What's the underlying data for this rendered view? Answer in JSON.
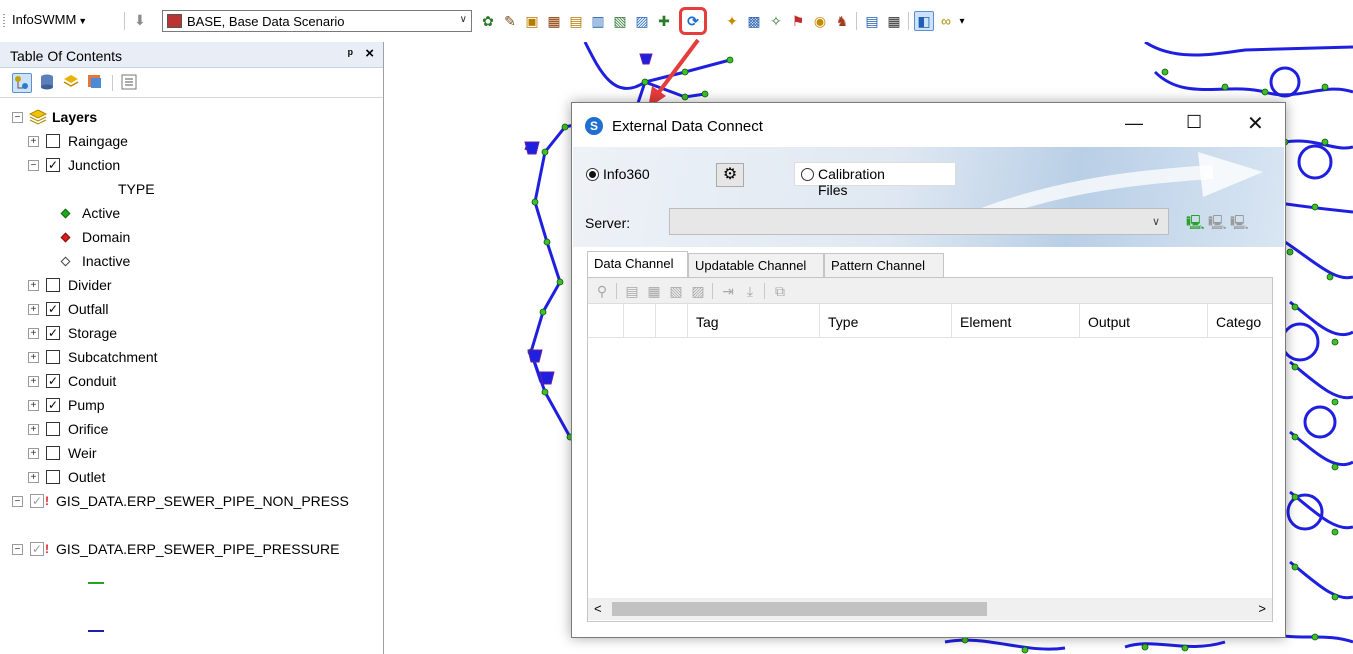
{
  "toolbar": {
    "menu_label": "InfoSWMM",
    "scenario_value": "BASE, Base Data Scenario"
  },
  "toc": {
    "title": "Table Of Contents",
    "root_label": "Layers",
    "layers": [
      {
        "label": "Raingage",
        "checked": false
      },
      {
        "label": "Junction",
        "checked": true
      },
      {
        "label": "Divider",
        "checked": false
      },
      {
        "label": "Outfall",
        "checked": true
      },
      {
        "label": "Storage",
        "checked": true
      },
      {
        "label": "Subcatchment",
        "checked": false
      },
      {
        "label": "Conduit",
        "checked": true
      },
      {
        "label": "Pump",
        "checked": true
      },
      {
        "label": "Orifice",
        "checked": false
      },
      {
        "label": "Weir",
        "checked": false
      },
      {
        "label": "Outlet",
        "checked": false
      },
      {
        "label": "GIS_DATA.ERP_SEWER_PIPE_NON_PRESS",
        "checked": true
      },
      {
        "label": "GIS_DATA.ERP_SEWER_PIPE_PRESSURE",
        "checked": true
      }
    ],
    "junction_legend": {
      "heading": "TYPE",
      "items": [
        {
          "label": "Active",
          "color": "#1fa81f"
        },
        {
          "label": "Domain",
          "color": "#d81f1f"
        },
        {
          "label": "Inactive",
          "color": "#ffffff"
        }
      ]
    }
  },
  "dialog": {
    "title": "External Data Connect",
    "radio_info360": "Info360",
    "radio_calibration": "Calibration Files",
    "server_label": "Server:",
    "tabs": [
      "Data Channel",
      "Updatable Channel",
      "Pattern Channel"
    ],
    "columns": [
      "Tag",
      "Type",
      "Element",
      "Output",
      "Catego"
    ]
  },
  "colors": {
    "pipe": "#1f1fe0",
    "node": "#3fbf2a",
    "highlight": "#e53c3c"
  }
}
